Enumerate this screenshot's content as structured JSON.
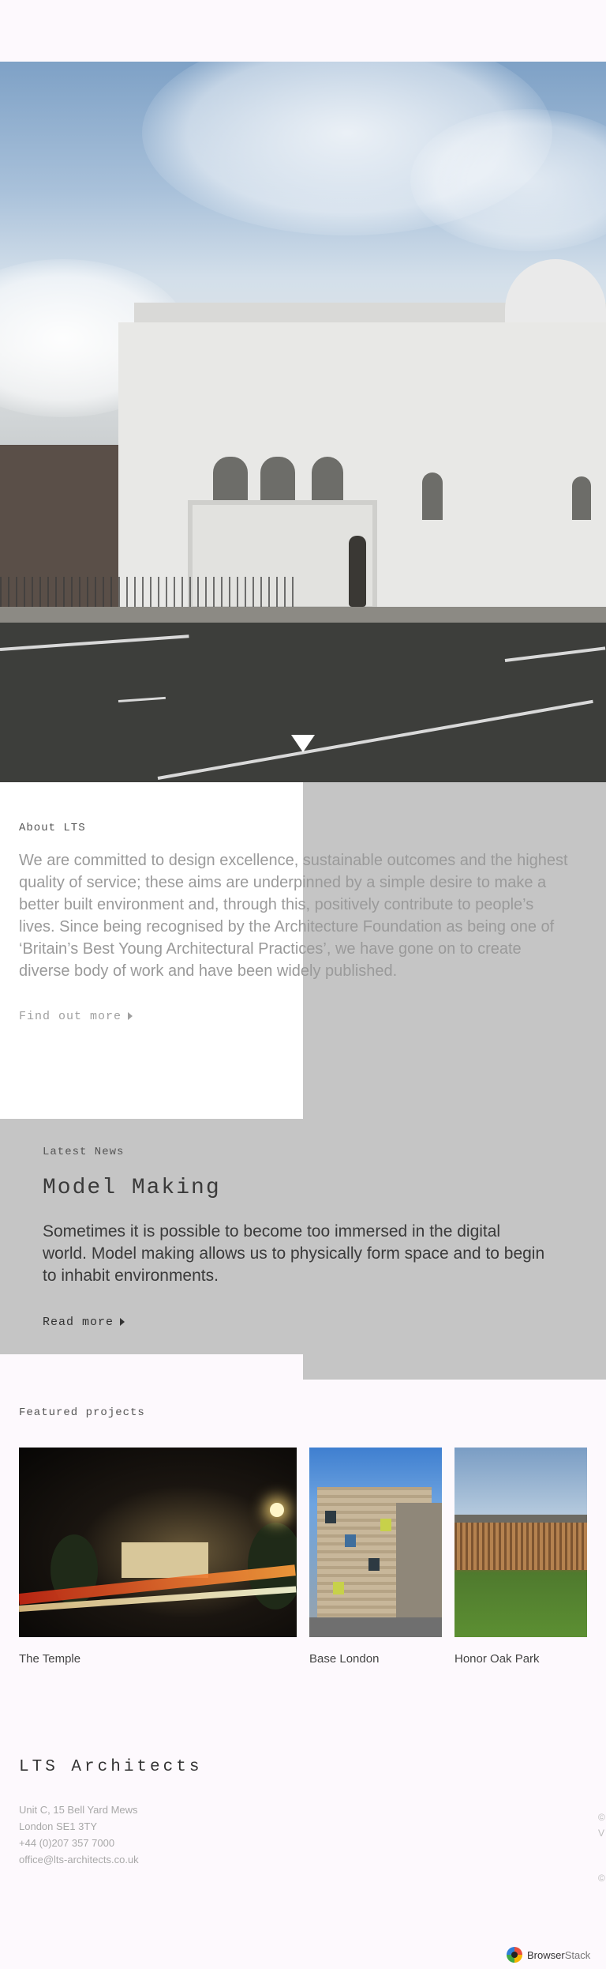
{
  "hero": {
    "alt_name": "temple-photograph",
    "scroll_icon": "triangle-down-icon"
  },
  "about": {
    "eyebrow": "About LTS",
    "text": "We are committed to design excellence, sustainable outcomes and the highest quality of service; these aims are underpinned by a simple desire to make a better built environment and, through this, positively contribute to people’s lives. Since being recognised by the Architecture Foundation as being one of ‘Britain’s Best Young Architectural Practices’, we have gone on to create diverse body of work and have been widely published.",
    "link": "Find out more"
  },
  "news": {
    "eyebrow": "Latest News",
    "title": "Model Making",
    "text": "Sometimes it is possible to become too immersed in the digital world. Model making allows us to physically form space and to begin to inhabit environments.",
    "link": "Read more"
  },
  "featured": {
    "heading": "Featured projects",
    "projects": [
      {
        "title": "The Temple"
      },
      {
        "title": "Base London"
      },
      {
        "title": "Honor Oak Park"
      }
    ]
  },
  "footer": {
    "title": "LTS Architects",
    "address": [
      "Unit C, 15 Bell Yard Mews",
      "London SE1 3TY",
      "+44 (0)207 357 7000",
      "office@lts-architects.co.uk"
    ],
    "edge": [
      "©",
      "V",
      "©"
    ]
  },
  "badge": {
    "name_a": "Browser",
    "name_b": "Stack"
  },
  "colors": {
    "grey_panel": "#c5c5c5",
    "background": "#fdf9fd"
  }
}
